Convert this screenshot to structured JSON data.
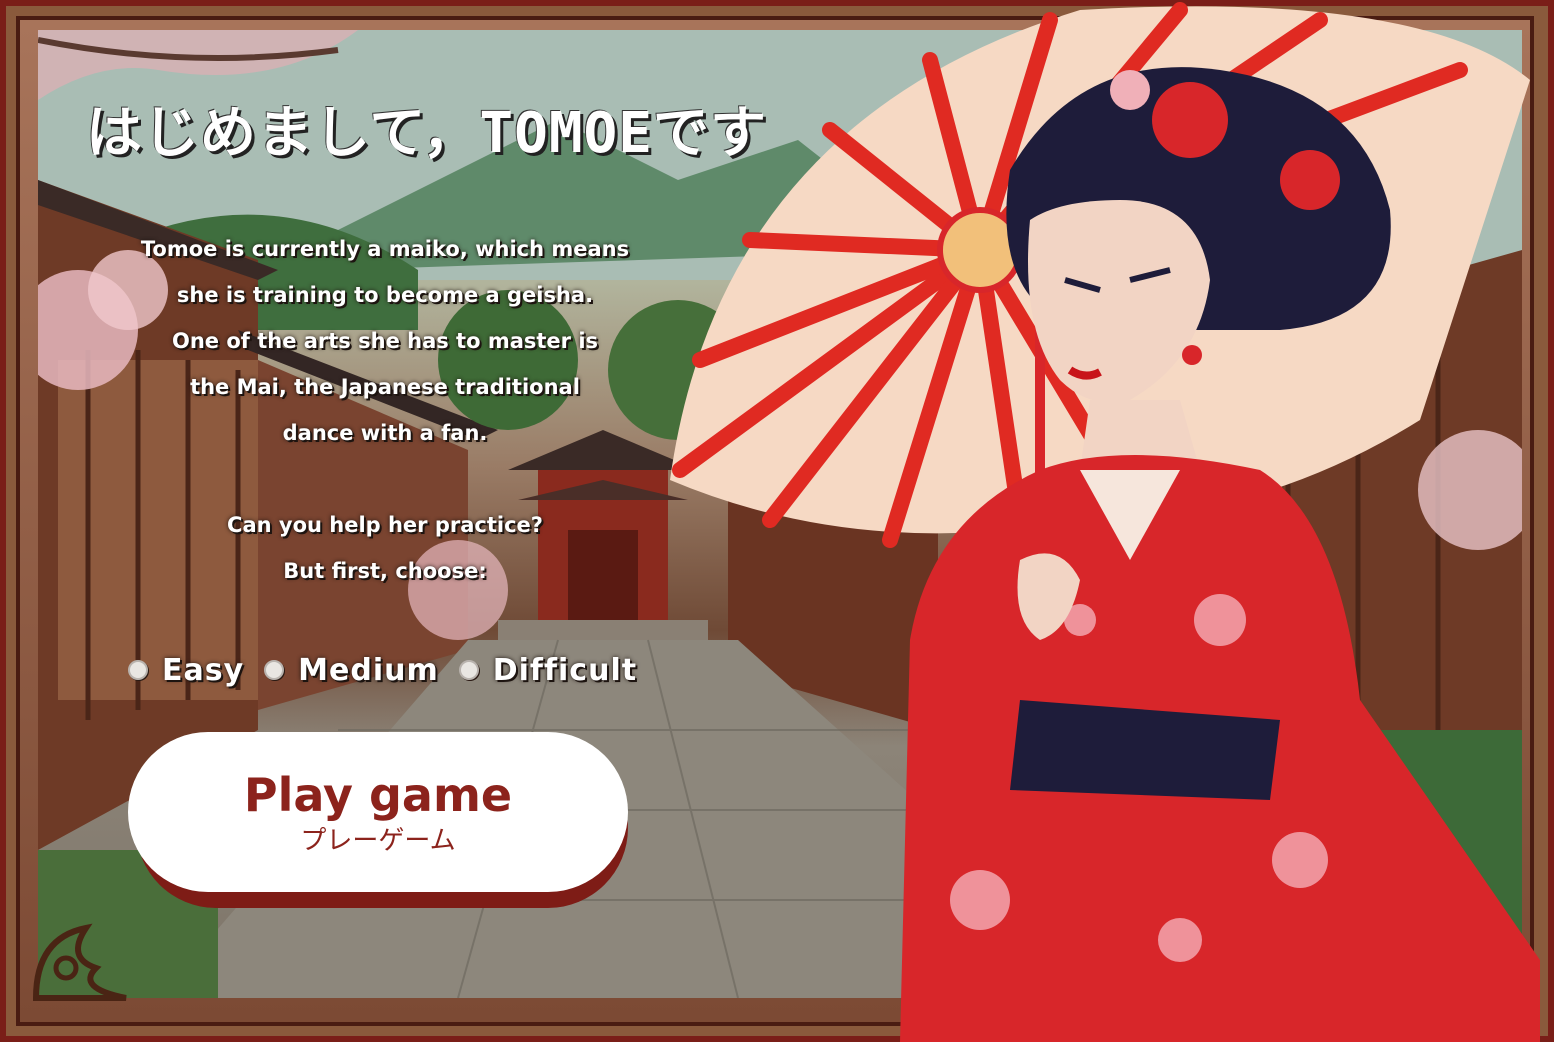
{
  "title": "はじめまして，TOMOEです",
  "intro": {
    "lines": [
      "Tomoe is currently a maiko, which means",
      "she is training to become a geisha.",
      "One of the arts she has to master is",
      "the Mai, the Japanese traditional",
      "dance with a fan."
    ],
    "question": "Can you help her practice?",
    "prompt": "But first, choose:"
  },
  "difficulty": {
    "options": [
      "Easy",
      "Medium",
      "Difficult"
    ]
  },
  "play_button": {
    "label": "Play game",
    "sublabel": "プレーゲーム"
  },
  "colors": {
    "accent": "#8c231c",
    "frame": "#7a1e18",
    "kimono": "#d8262a",
    "umbrella_stripe": "#e02a22",
    "umbrella_paper": "#f6d9c4"
  },
  "icons": {
    "character": "geisha-character",
    "umbrella": "wagasa-umbrella-icon",
    "ornament": "corner-ornament-icon"
  }
}
